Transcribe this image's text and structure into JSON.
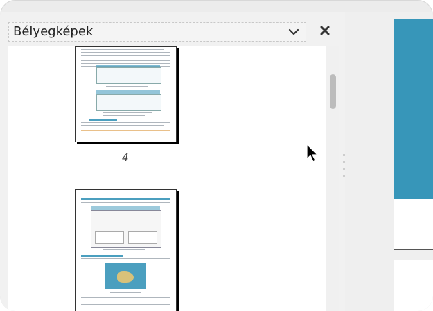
{
  "sidebar": {
    "title": "Bélyegképek",
    "dropdown_icon": "chevron-down-icon",
    "close_icon": "close-icon"
  },
  "thumbnails": [
    {
      "page_label": "4"
    },
    {
      "page_label": ""
    }
  ],
  "colors": {
    "accent": "#3796b9",
    "panel_bg": "#f1f1f1"
  }
}
